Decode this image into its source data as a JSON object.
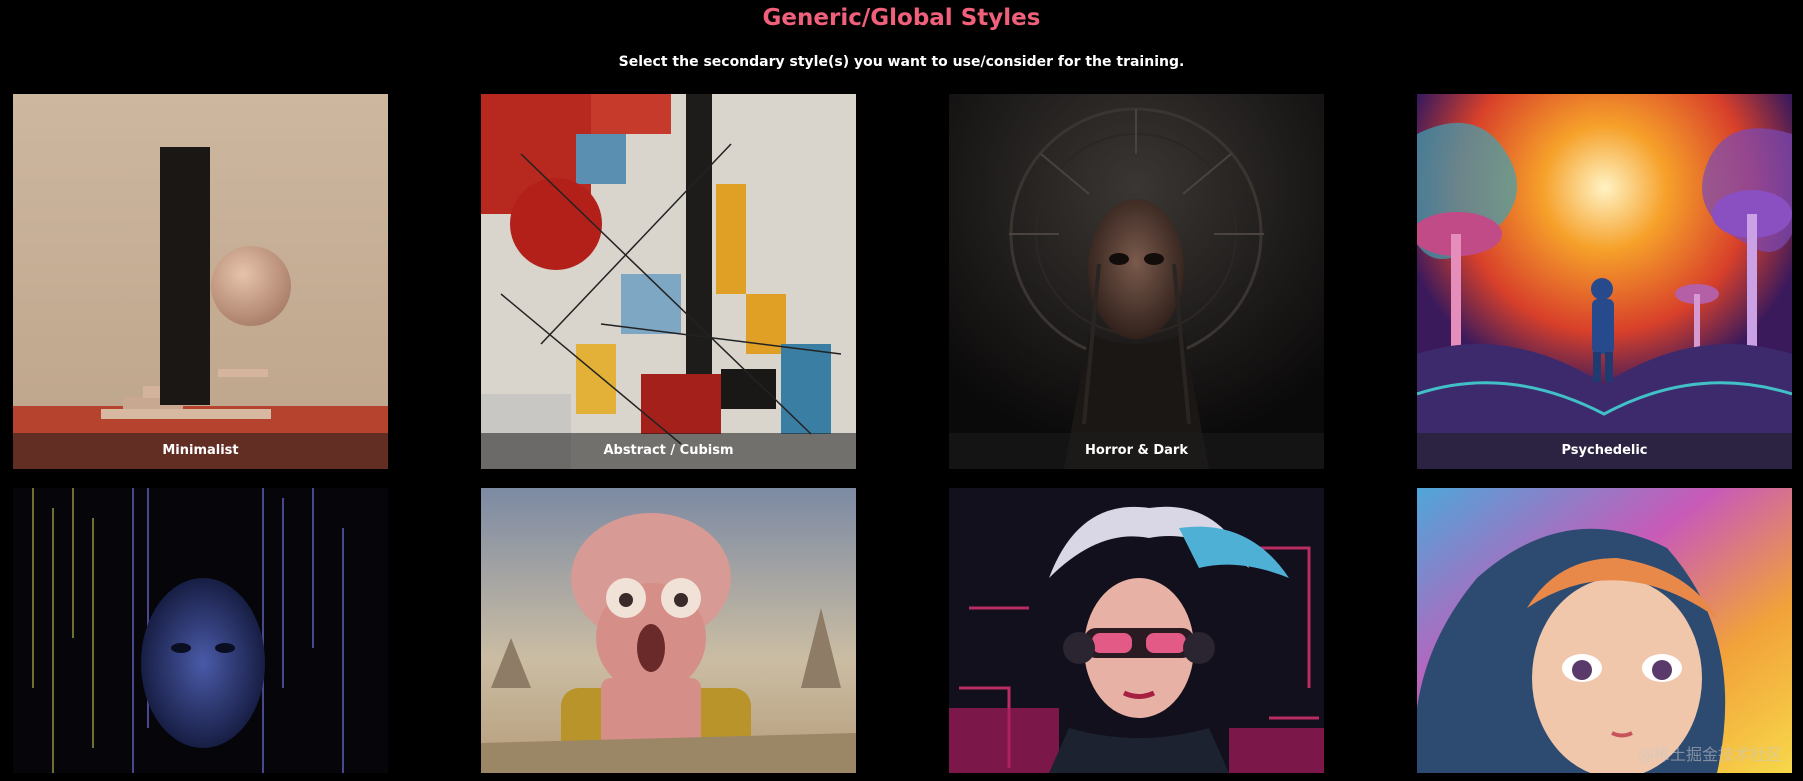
{
  "header": {
    "title": "Generic/Global Styles",
    "subtitle": "Select the secondary style(s) you want to use/consider for the training."
  },
  "styles": [
    {
      "label": "Minimalist"
    },
    {
      "label": "Abstract / Cubism"
    },
    {
      "label": "Horror & Dark"
    },
    {
      "label": "Psychedelic"
    },
    {
      "label": ""
    },
    {
      "label": ""
    },
    {
      "label": ""
    },
    {
      "label": ""
    }
  ],
  "watermark": "@稀土掘金技术社区",
  "colors": {
    "background": "#000000",
    "title": "#f0607a",
    "subtitle": "#ffffff"
  }
}
